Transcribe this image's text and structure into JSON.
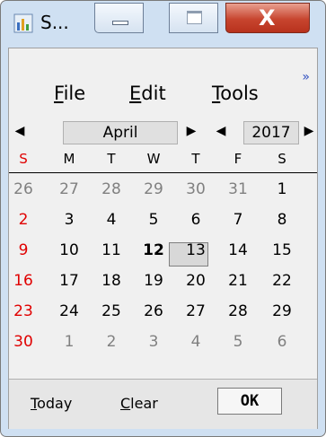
{
  "window": {
    "title": "S...",
    "close_glyph": "X"
  },
  "menu": {
    "items": [
      {
        "label": "File",
        "underline": "F"
      },
      {
        "label": "Edit",
        "underline": "E"
      },
      {
        "label": "Tools",
        "underline": "T"
      }
    ],
    "overflow": "»"
  },
  "nav": {
    "prev": "◀",
    "next": "▶",
    "month": "April",
    "year": "2017"
  },
  "calendar": {
    "weekdays": [
      "S",
      "M",
      "T",
      "W",
      "T",
      "F",
      "S"
    ],
    "weeks": [
      [
        "26",
        "27",
        "28",
        "29",
        "30",
        "31",
        "1"
      ],
      [
        "2",
        "3",
        "4",
        "5",
        "6",
        "7",
        "8"
      ],
      [
        "9",
        "10",
        "11",
        "12",
        "13",
        "14",
        "15"
      ],
      [
        "16",
        "17",
        "18",
        "19",
        "20",
        "21",
        "22"
      ],
      [
        "23",
        "24",
        "25",
        "26",
        "27",
        "28",
        "29"
      ],
      [
        "30",
        "1",
        "2",
        "3",
        "4",
        "5",
        "6"
      ]
    ],
    "selected": "12"
  },
  "footer": {
    "today": "Today",
    "clear": "Clear",
    "ok": "OK"
  },
  "colors": {
    "sunday": "#e00000",
    "other_month": "#808080"
  }
}
